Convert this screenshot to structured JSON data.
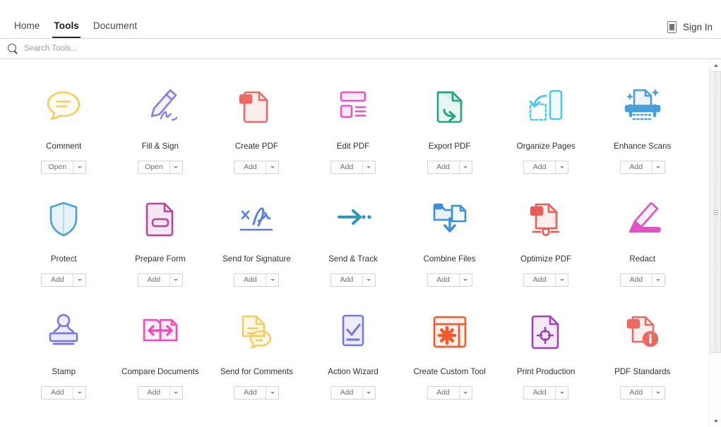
{
  "topbar": {
    "tabs": [
      {
        "label": "Home",
        "active": false
      },
      {
        "label": "Tools",
        "active": true
      },
      {
        "label": "Document",
        "active": false
      }
    ],
    "device_icon": "mobile-device-icon",
    "signin_label": "Sign In"
  },
  "search": {
    "icon": "search-icon",
    "placeholder": "Search Tools...",
    "value": ""
  },
  "tools": [
    {
      "label": "Comment",
      "icon": "comment-bubble-icon",
      "action": "Open",
      "color": "#f2cd5c"
    },
    {
      "label": "Fill & Sign",
      "icon": "pen-signature-icon",
      "action": "Open",
      "color": "#8681e0"
    },
    {
      "label": "Create PDF",
      "icon": "create-pdf-icon",
      "action": "Add",
      "color": "#e96a63"
    },
    {
      "label": "Edit PDF",
      "icon": "edit-pdf-icon",
      "action": "Add",
      "color": "#e455c8"
    },
    {
      "label": "Export PDF",
      "icon": "export-pdf-icon",
      "action": "Add",
      "color": "#23a37e"
    },
    {
      "label": "Organize Pages",
      "icon": "organize-pages-icon",
      "action": "Add",
      "color": "#4ec8ea"
    },
    {
      "label": "Enhance Scans",
      "icon": "enhance-scans-icon",
      "action": "Add",
      "color": "#4a9fd8"
    },
    {
      "label": "Protect",
      "icon": "shield-icon",
      "action": "Add",
      "color": "#4a9fd8"
    },
    {
      "label": "Prepare Form",
      "icon": "prepare-form-icon",
      "action": "Add",
      "color": "#b8439a"
    },
    {
      "label": "Send for Signature",
      "icon": "send-signature-icon",
      "action": "Add",
      "color": "#5b7ee0"
    },
    {
      "label": "Send & Track",
      "icon": "send-track-icon",
      "action": "Add",
      "color": "#2e95b5"
    },
    {
      "label": "Combine Files",
      "icon": "combine-files-icon",
      "action": "Add",
      "color": "#3d8fd6"
    },
    {
      "label": "Optimize PDF",
      "icon": "optimize-pdf-icon",
      "action": "Add",
      "color": "#ea5c55"
    },
    {
      "label": "Redact",
      "icon": "redact-marker-icon",
      "action": "Add",
      "color": "#e053c0"
    },
    {
      "label": "Stamp",
      "icon": "stamp-icon",
      "action": "Add",
      "color": "#7b78dd"
    },
    {
      "label": "Compare Documents",
      "icon": "compare-documents-icon",
      "action": "Add",
      "color": "#ef4bb8"
    },
    {
      "label": "Send for Comments",
      "icon": "send-comments-icon",
      "action": "Add",
      "color": "#f2cd5c"
    },
    {
      "label": "Action Wizard",
      "icon": "action-wizard-icon",
      "action": "Add",
      "color": "#7b78dd"
    },
    {
      "label": "Create Custom Tool",
      "icon": "custom-tool-gear-icon",
      "action": "Add",
      "color": "#ec5c2e"
    },
    {
      "label": "Print Production",
      "icon": "print-production-icon",
      "action": "Add",
      "color": "#9b44b8"
    },
    {
      "label": "PDF Standards",
      "icon": "pdf-standards-icon",
      "action": "Add",
      "color": "#e96a63"
    }
  ],
  "scrollbar": {
    "up_arrow": "scroll-up-arrow-icon",
    "down_arrow": "scroll-down-arrow-icon",
    "thumb": "scrollbar-thumb"
  }
}
